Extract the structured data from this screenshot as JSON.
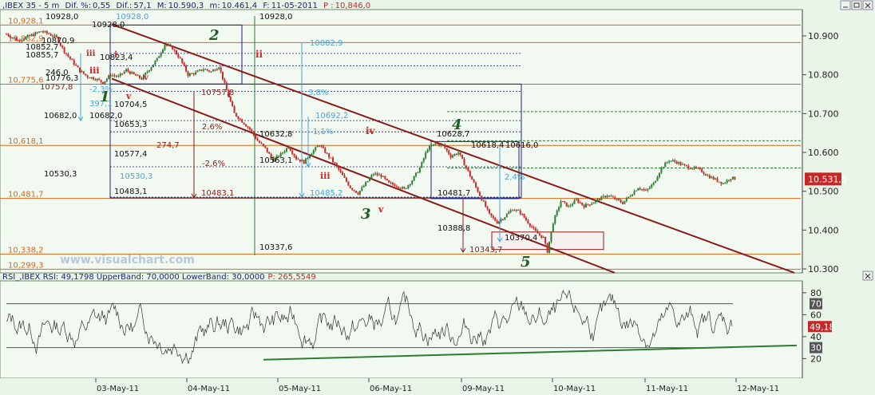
{
  "main_header": {
    "symbol": "IBEX 35",
    "timeframe": "5 m",
    "dif_pct_label": "Dif. %:",
    "dif_pct": "0,55",
    "dif_label": "Dif.:",
    "dif": "57,1",
    "max_label": "M:",
    "max": "10.590,3",
    "min_label": "m:",
    "min": "10.461,4",
    "date_label": "F:",
    "date": "11-05-2011",
    "price_label": "P :",
    "price": "10,846,0"
  },
  "rsi_header": {
    "text": "RSI_,IBEX RSI: 49,1798 UpperBand: 70,0000 LowerBand: 30,0000",
    "p_text": "P: 265,5549"
  },
  "watermark": "www.visualchart.com",
  "colors": {
    "background": "#eaf5ea",
    "up_candle": "#2e7d32",
    "down_candle": "#c62828",
    "channel": "#8b1a1a",
    "fib_line": "#d2691e",
    "blue": "#1a237e",
    "light_blue": "#4aa3df",
    "wave_green": "#1b5e20",
    "wave_red": "#c62828"
  },
  "chart_data": [
    {
      "type": "candlestick",
      "symbol": "IBEX 35",
      "interval": "5 m",
      "y_axis_ticks": [
        "10.900",
        "10.800",
        "10.700",
        "10.600",
        "10.500",
        "10.400",
        "10.300"
      ],
      "ylim": [
        10285,
        10945
      ],
      "x_tick_labels": [
        "03-May-11",
        "04-May-11",
        "05-May-11",
        "06-May-11",
        "09-May-11",
        "10-May-11",
        "11-May-11",
        "12-May-11"
      ],
      "last_price_label": "10.531,5",
      "close_path": [
        [
          0,
          10905
        ],
        [
          6,
          10888
        ],
        [
          12,
          10900
        ],
        [
          18,
          10912
        ],
        [
          22,
          10905
        ],
        [
          26,
          10895
        ],
        [
          30,
          10860
        ],
        [
          34,
          10835
        ],
        [
          38,
          10810
        ],
        [
          42,
          10795
        ],
        [
          46,
          10790
        ],
        [
          50,
          10780
        ],
        [
          54,
          10800
        ],
        [
          58,
          10795
        ],
        [
          62,
          10812
        ],
        [
          66,
          10800
        ],
        [
          70,
          10790
        ],
        [
          74,
          10815
        ],
        [
          78,
          10840
        ],
        [
          82,
          10878
        ],
        [
          86,
          10868
        ],
        [
          90,
          10840
        ],
        [
          94,
          10800
        ],
        [
          98,
          10805
        ],
        [
          102,
          10815
        ],
        [
          106,
          10808
        ],
        [
          110,
          10822
        ],
        [
          114,
          10760
        ],
        [
          118,
          10700
        ],
        [
          122,
          10680
        ],
        [
          126,
          10660
        ],
        [
          130,
          10630
        ],
        [
          134,
          10610
        ],
        [
          138,
          10580
        ],
        [
          142,
          10595
        ],
        [
          146,
          10615
        ],
        [
          150,
          10585
        ],
        [
          154,
          10575
        ],
        [
          158,
          10600
        ],
        [
          162,
          10620
        ],
        [
          166,
          10595
        ],
        [
          170,
          10570
        ],
        [
          174,
          10540
        ],
        [
          178,
          10510
        ],
        [
          182,
          10495
        ],
        [
          186,
          10520
        ],
        [
          190,
          10545
        ],
        [
          194,
          10540
        ],
        [
          198,
          10520
        ],
        [
          202,
          10515
        ],
        [
          206,
          10505
        ],
        [
          210,
          10528
        ],
        [
          214,
          10560
        ],
        [
          218,
          10610
        ],
        [
          222,
          10622
        ],
        [
          226,
          10618
        ],
        [
          230,
          10590
        ],
        [
          234,
          10600
        ],
        [
          238,
          10560
        ],
        [
          242,
          10520
        ],
        [
          246,
          10480
        ],
        [
          250,
          10440
        ],
        [
          254,
          10420
        ],
        [
          258,
          10435
        ],
        [
          262,
          10455
        ],
        [
          266,
          10445
        ],
        [
          270,
          10420
        ],
        [
          274,
          10395
        ],
        [
          278,
          10380
        ],
        [
          280,
          10345
        ],
        [
          283,
          10420
        ],
        [
          287,
          10475
        ],
        [
          291,
          10460
        ],
        [
          295,
          10478
        ],
        [
          299,
          10462
        ],
        [
          303,
          10470
        ],
        [
          307,
          10480
        ],
        [
          311,
          10490
        ],
        [
          315,
          10480
        ],
        [
          319,
          10470
        ],
        [
          323,
          10490
        ],
        [
          327,
          10510
        ],
        [
          331,
          10500
        ],
        [
          335,
          10520
        ],
        [
          339,
          10560
        ],
        [
          343,
          10580
        ],
        [
          347,
          10575
        ],
        [
          351,
          10565
        ],
        [
          355,
          10560
        ],
        [
          359,
          10555
        ],
        [
          363,
          10540
        ],
        [
          367,
          10530
        ],
        [
          371,
          10520
        ],
        [
          375,
          10535
        ],
        [
          378,
          10531
        ]
      ],
      "horizontal_levels": [
        {
          "label": "10,928,1",
          "value": 10928.1,
          "color": "orange"
        },
        {
          "label": "10,882,9",
          "value": 10882.9,
          "color": "orange"
        },
        {
          "label": "10,775,6",
          "value": 10775.6,
          "color": "orange"
        },
        {
          "label": "10,618,1",
          "value": 10618.1,
          "color": "orange"
        },
        {
          "label": "10,481,7",
          "value": 10481.7,
          "color": "orange"
        },
        {
          "label": "10,338,2",
          "value": 10338.2,
          "color": "orange"
        },
        {
          "label": "10,299,3",
          "value": 10299.3,
          "color": "orange"
        }
      ],
      "annotations": [
        {
          "text": "10928,0"
        },
        {
          "text": "10928,0"
        },
        {
          "text": "10928,0"
        },
        {
          "text": "10928,0"
        },
        {
          "text": "10882,9"
        },
        {
          "text": "10870,9"
        },
        {
          "text": "10852,7"
        },
        {
          "text": "10855,7"
        },
        {
          "text": "10823,4"
        },
        {
          "text": "10776,3"
        },
        {
          "text": "10757,8"
        },
        {
          "text": "10757,8"
        },
        {
          "text": "10704,5"
        },
        {
          "text": "10692,2"
        },
        {
          "text": "10682,0"
        },
        {
          "text": "10682,0"
        },
        {
          "text": "10653,3"
        },
        {
          "text": "10632,8"
        },
        {
          "text": "10628,7"
        },
        {
          "text": "10618,4"
        },
        {
          "text": "10616,0"
        },
        {
          "text": "10577,4"
        },
        {
          "text": "10563,1"
        },
        {
          "text": "10530,3"
        },
        {
          "text": "10530,3"
        },
        {
          "text": "10485,2"
        },
        {
          "text": "10483,1"
        },
        {
          "text": "10483,1"
        },
        {
          "text": "10481,7"
        },
        {
          "text": "10388,8"
        },
        {
          "text": "10370,4"
        },
        {
          "text": "10343,7"
        },
        {
          "text": "10337,6"
        },
        {
          "text": "274,7"
        },
        {
          "text": "2,6%"
        },
        {
          "text": "-2,6%"
        },
        {
          "text": "3,8%"
        },
        {
          "text": "2,4%"
        },
        {
          "text": "-2,3%"
        },
        {
          "text": "397,1"
        },
        {
          "text": "246,0"
        },
        {
          "text": "1,1%"
        }
      ],
      "wave_labels": [
        {
          "text": "1"
        },
        {
          "text": "2"
        },
        {
          "text": "3"
        },
        {
          "text": "4"
        },
        {
          "text": "5"
        },
        {
          "text": "i"
        },
        {
          "text": "ii"
        },
        {
          "text": "iii"
        },
        {
          "text": "iv"
        },
        {
          "text": "v"
        },
        {
          "text": "iii"
        },
        {
          "text": "v"
        },
        {
          "text": "i"
        },
        {
          "text": "iii"
        },
        {
          "text": "v"
        }
      ]
    },
    {
      "type": "line",
      "name": "RSI",
      "y_axis_ticks": [
        "80",
        "60",
        "40",
        "20"
      ],
      "ylim": [
        5,
        85
      ],
      "upper_band": 70,
      "lower_band": 30,
      "band_labels": [
        "70",
        "30"
      ],
      "last_value_label": "49,18",
      "x_tick_labels": [
        "03-May-11",
        "04-May-11",
        "05-May-11",
        "06-May-11",
        "09-May-11",
        "10-May-11",
        "11-May-11",
        "12-May-11"
      ]
    }
  ]
}
